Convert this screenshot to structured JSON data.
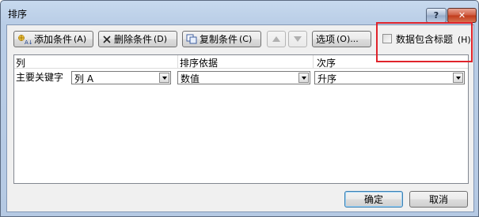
{
  "window": {
    "title": "排序",
    "help_glyph": "?",
    "close_glyph": "✕"
  },
  "toolbar": {
    "add_label": "添加条件",
    "add_accel": "(A)",
    "delete_label": "删除条件",
    "delete_accel": "(D)",
    "copy_label": "复制条件",
    "copy_accel": "(C)",
    "options_label": "选项",
    "options_accel": "(O)...",
    "header_checkbox_label": "数据包含标题",
    "header_checkbox_accel": "(H)",
    "header_checkbox_checked": false
  },
  "grid": {
    "columns": [
      "列",
      "排序依据",
      "次序"
    ],
    "rows": [
      {
        "label": "主要关键字",
        "column_value": "列 A",
        "sort_on_value": "数值",
        "order_value": "升序"
      }
    ]
  },
  "footer": {
    "ok_label": "确定",
    "cancel_label": "取消"
  },
  "colors": {
    "highlight": "#e0232b",
    "titlebar": "#c7d9ee",
    "close_button": "#c03a1a"
  }
}
